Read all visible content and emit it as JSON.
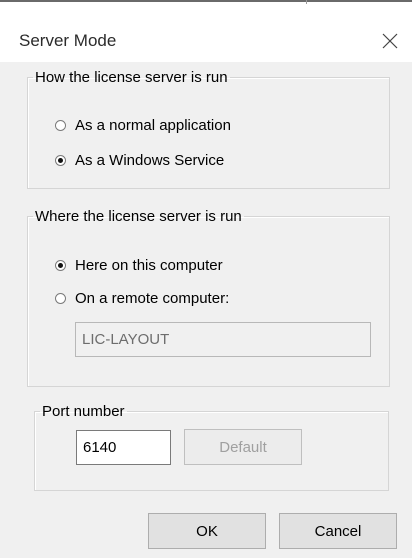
{
  "dialog": {
    "title": "Server Mode"
  },
  "run_mode": {
    "legend": "How the license server is run",
    "options": [
      {
        "label": "As a normal application",
        "checked": false
      },
      {
        "label": "As a Windows Service",
        "checked": true
      }
    ]
  },
  "location": {
    "legend": "Where the license server is run",
    "options": [
      {
        "label": "Here on this computer",
        "checked": true
      },
      {
        "label": "On a remote computer:",
        "checked": false
      }
    ],
    "remote_computer_value": "LIC-LAYOUT"
  },
  "port": {
    "legend": "Port number",
    "value": "6140",
    "default_label": "Default"
  },
  "buttons": {
    "ok_label": "OK",
    "cancel_label": "Cancel"
  }
}
